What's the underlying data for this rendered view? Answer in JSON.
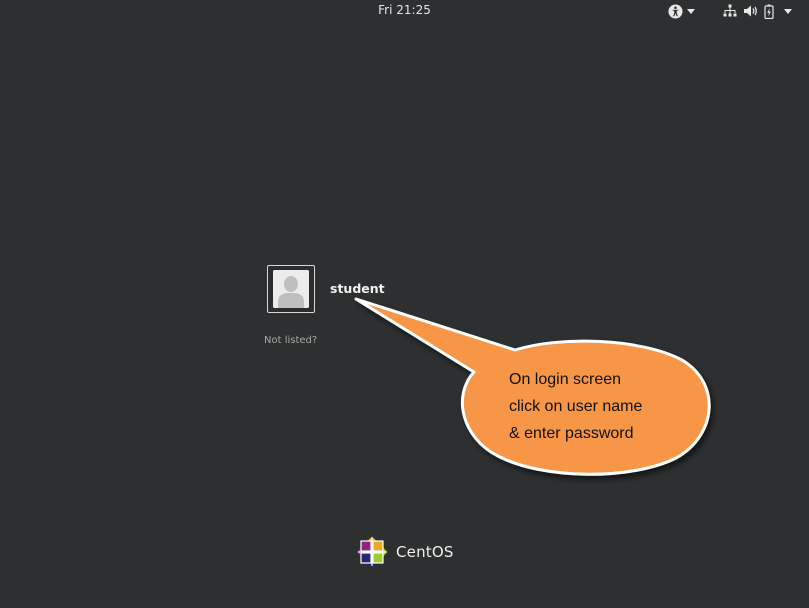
{
  "topbar": {
    "clock": "Fri 21:25",
    "tray_icons": [
      "accessibility-icon",
      "network-icon",
      "volume-icon",
      "battery-icon"
    ]
  },
  "login": {
    "users": [
      {
        "name": "student",
        "avatar_icon": "user-silhouette-icon"
      }
    ],
    "not_listed_label": "Not listed?"
  },
  "annotation": {
    "lines": [
      "On login screen",
      "click on user name",
      "& enter  password"
    ],
    "fill_color": "#f79646",
    "border_color": "#ffffff"
  },
  "brand": {
    "name": "CentOS",
    "logo_icon": "centos-logo-icon"
  },
  "colors": {
    "background": "#2d2f30",
    "text": "#f2f2f2",
    "muted_text": "#a8a8a8"
  }
}
